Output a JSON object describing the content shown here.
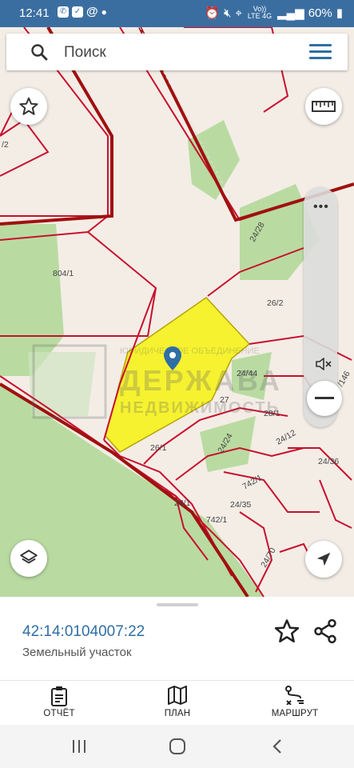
{
  "status_bar": {
    "time": "12:41",
    "notification_icons": [
      "whatsapp-icon",
      "check-icon",
      "at-icon",
      "dot"
    ],
    "network": "Vo)) LTE 4G",
    "battery": "60%"
  },
  "search": {
    "placeholder": "Поиск"
  },
  "map": {
    "parcel_labels": [
      "804/1",
      "24/28",
      "26/2",
      "24/44",
      "27",
      "28/1",
      "26/1",
      "24/24",
      "24/12",
      "24/36",
      "742/1",
      "24/35",
      "28/1",
      "742/1",
      "24/70",
      "/2",
      "/146"
    ],
    "watermark_line1": "ЮРИДИЧЕСКОЕ ОБЪЕДИНЕНИЕ",
    "watermark_line2": "ДЕРЖАВА",
    "watermark_line3": "НЕДВИЖИМОСТЬ",
    "colors": {
      "parcel_border": "#c8102e",
      "selected_fill": "#f6f22f",
      "forest": "#b9dba1",
      "background": "#f3ede6",
      "pin": "#2f6ea5"
    }
  },
  "info_sheet": {
    "cadastral_number": "42:14:0104007:22",
    "object_type": "Земельный участок"
  },
  "bottom_nav": {
    "report_label": "ОТЧЁТ",
    "plan_label": "ПЛАН",
    "route_label": "МАРШРУТ"
  },
  "icons": {
    "favorite": "star-icon",
    "ruler": "ruler-icon",
    "layers": "layers-icon",
    "locate": "navigation-arrow-icon",
    "mute": "mute-icon",
    "zoom_out": "minus-icon",
    "more": "more-dots-icon"
  }
}
